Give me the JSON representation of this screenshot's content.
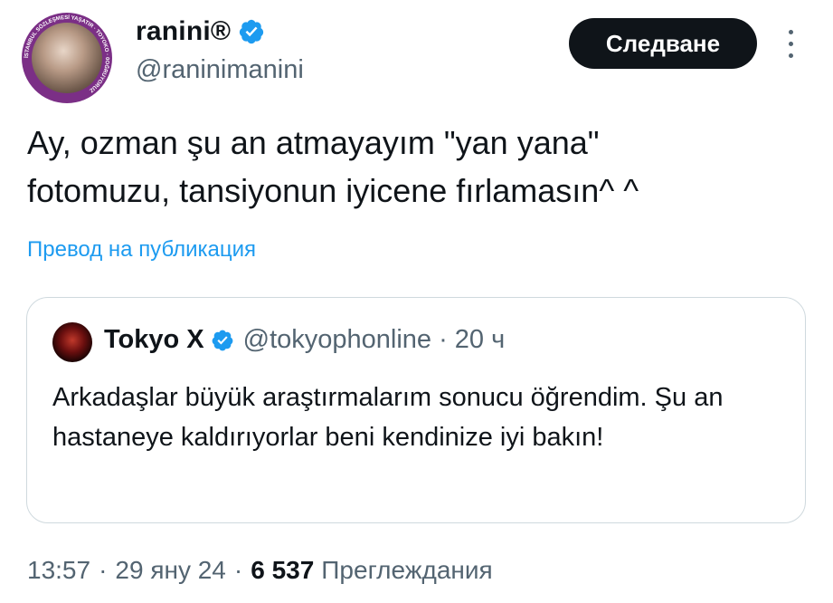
{
  "author": {
    "display_name": "ranini®",
    "handle": "@raninimanini",
    "avatar_ring_text": "İSTANBUL SÖZLEŞMESİ YAŞATIR · TOYOKO · 0OĞRUYORUZ",
    "verified": true
  },
  "follow_button": {
    "label": "Следване"
  },
  "tweet": {
    "text": "Ay, ozman şu an atmayayım \"yan yana\"\nfotomuzu, tansiyonun iyicene fırlamasın^ ^",
    "translate_link": "Превод на публикация"
  },
  "quoted_tweet": {
    "display_name": "Tokyo X",
    "handle": "@tokyophonline",
    "time": "20 ч",
    "verified": true,
    "text": "Arkadaşlar büyük araştırmalarım sonucu öğrendim.  Şu an hastaneye kaldırıyorlar beni kendinize iyi bakın!"
  },
  "meta": {
    "time": "13:57",
    "date": "29 яну 24",
    "views_count": "6 537",
    "views_label": "Преглеждания"
  },
  "colors": {
    "verified_blue": "#1d9bf0",
    "link_blue": "#1d9bf0",
    "secondary_text": "#536471",
    "button_bg": "#0f1419",
    "avatar_ring": "#7b2f86"
  }
}
